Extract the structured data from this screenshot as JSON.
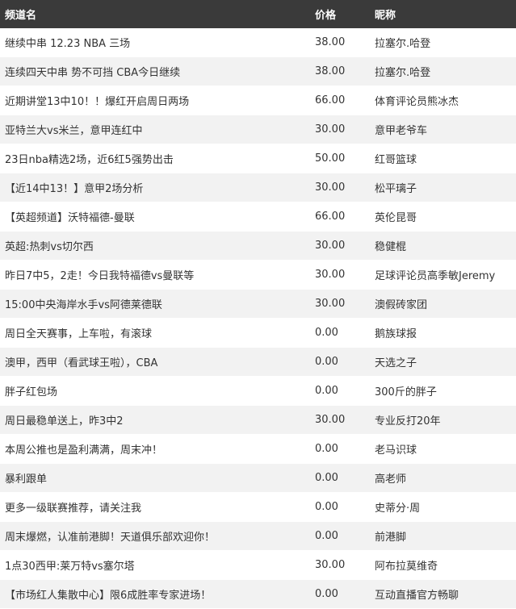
{
  "header": {
    "channel": "频道名",
    "price": "价格",
    "nickname": "昵称"
  },
  "rows": [
    {
      "title": "继续中串 12.23 NBA 三场",
      "price": "38.00",
      "nickname": "拉塞尔.哈登"
    },
    {
      "title": "连续四天中串 势不可挡 CBA今日继续",
      "price": "38.00",
      "nickname": "拉塞尔.哈登"
    },
    {
      "title": "近期讲堂13中10！！爆红开启周日两场",
      "price": "66.00",
      "nickname": "体育评论员熊冰杰"
    },
    {
      "title": "亚特兰大vs米兰，意甲连红中",
      "price": "30.00",
      "nickname": "意甲老爷车"
    },
    {
      "title": "23日nba精选2场，近6红5强势出击",
      "price": "50.00",
      "nickname": "红哥篮球"
    },
    {
      "title": "【近14中13！】意甲2场分析",
      "price": "30.00",
      "nickname": "松平璃子"
    },
    {
      "title": "【英超频道】沃特福德-曼联",
      "price": "66.00",
      "nickname": "英伦昆哥"
    },
    {
      "title": "英超:热刺vs切尔西",
      "price": "30.00",
      "nickname": "稳健棍"
    },
    {
      "title": "昨日7中5，2走！今日我特福德vs曼联等",
      "price": "30.00",
      "nickname": "足球评论员高季敏Jeremy"
    },
    {
      "title": "15:00中央海岸水手vs阿德莱德联",
      "price": "30.00",
      "nickname": "澳假砖家团"
    },
    {
      "title": "周日全天赛事，上车啦，有滚球",
      "price": "0.00",
      "nickname": "鹅族球报"
    },
    {
      "title": "澳甲，西甲（看武球王啦），CBA",
      "price": "0.00",
      "nickname": "天选之子"
    },
    {
      "title": "胖子红包场",
      "price": "0.00",
      "nickname": "300斤的胖子"
    },
    {
      "title": "周日最稳单送上，昨3中2",
      "price": "30.00",
      "nickname": "专业反打20年"
    },
    {
      "title": "本周公推也是盈利满满，周末冲！",
      "price": "0.00",
      "nickname": "老马识球"
    },
    {
      "title": "暴利跟单",
      "price": "0.00",
      "nickname": "高老师"
    },
    {
      "title": "更多一级联赛推荐，请关注我",
      "price": "0.00",
      "nickname": "史蒂分·周"
    },
    {
      "title": "周末爆燃，认准前港脚！天道俱乐部欢迎你！",
      "price": "0.00",
      "nickname": "前港脚"
    },
    {
      "title": "1点30西甲:莱万特vs塞尔塔",
      "price": "30.00",
      "nickname": "阿布拉莫维奇"
    },
    {
      "title": "【市场红人集散中心】限6成胜率专家进场！",
      "price": "0.00",
      "nickname": "互动直播官方畅聊"
    }
  ]
}
